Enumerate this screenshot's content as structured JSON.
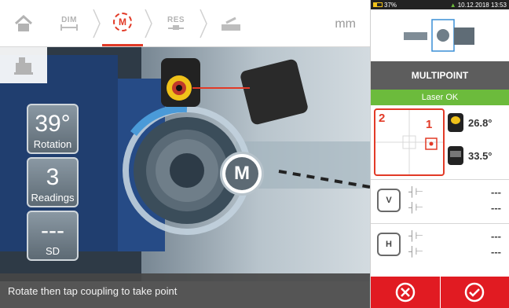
{
  "toolbar": {
    "home_icon": "home-icon",
    "dim": {
      "label": "DIM",
      "icon": "dimensions-icon"
    },
    "measure": {
      "label": "M",
      "icon": "measure-icon"
    },
    "res": {
      "label": "RES",
      "icon": "results-icon"
    },
    "move_icon": "move-icon",
    "unit": "mm",
    "accent": "#e23a27"
  },
  "side_button": {
    "icon": "machine-train-icon"
  },
  "readouts": {
    "rotation": {
      "value": "39°",
      "label": "Rotation"
    },
    "readings": {
      "value": "3",
      "label": "Readings"
    },
    "sd": {
      "value": "---",
      "label": "SD"
    }
  },
  "coupling_button": {
    "label": "M"
  },
  "status_text": "Rotate then tap coupling to take point",
  "right_panel": {
    "system": {
      "battery": "37%",
      "datetime": "10.12.2018 13:53"
    },
    "title": "MULTIPOINT",
    "laser_status": "Laser OK",
    "target": {
      "sensor2_label": "2",
      "sensor1_label": "1"
    },
    "sensors": [
      {
        "value": "26.8°",
        "icon": "sensor-1-icon"
      },
      {
        "value": "33.5°",
        "icon": "sensor-2-icon"
      }
    ],
    "vertical": {
      "icon": "vertical-view-icon",
      "offset": "---",
      "angularity": "---"
    },
    "horizontal": {
      "icon": "horizontal-view-icon",
      "offset": "---",
      "angularity": "---"
    },
    "cancel_icon": "cancel-icon",
    "confirm_icon": "confirm-icon",
    "colors": {
      "laser_ok": "#6cbb3c",
      "action": "#e11b22",
      "title_bg": "#5d5d5d"
    }
  }
}
